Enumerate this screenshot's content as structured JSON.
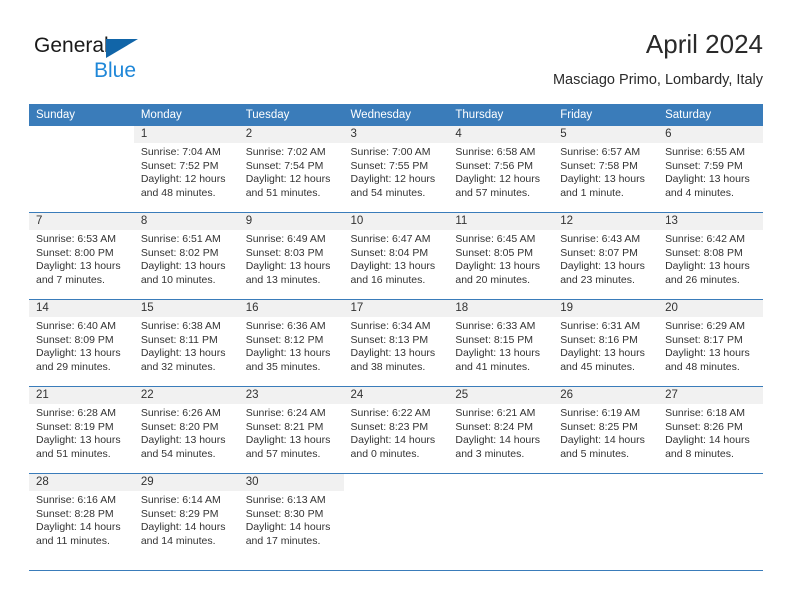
{
  "brand": {
    "name_part1": "General",
    "name_part2": "Blue",
    "triangle_color": "#1165a8",
    "blue_color": "#1f87d8"
  },
  "header": {
    "title": "April 2024",
    "subtitle": "Masciago Primo, Lombardy, Italy"
  },
  "theme": {
    "header_blue": "#3a7cba",
    "daynum_band": "#f1f1f1",
    "text": "#333333"
  },
  "weekdays": [
    "Sunday",
    "Monday",
    "Tuesday",
    "Wednesday",
    "Thursday",
    "Friday",
    "Saturday"
  ],
  "weeks": [
    [
      {
        "day": "",
        "sunrise": "",
        "sunset": "",
        "daylight1": "",
        "daylight2": ""
      },
      {
        "day": "1",
        "sunrise": "Sunrise: 7:04 AM",
        "sunset": "Sunset: 7:52 PM",
        "daylight1": "Daylight: 12 hours",
        "daylight2": "and 48 minutes."
      },
      {
        "day": "2",
        "sunrise": "Sunrise: 7:02 AM",
        "sunset": "Sunset: 7:54 PM",
        "daylight1": "Daylight: 12 hours",
        "daylight2": "and 51 minutes."
      },
      {
        "day": "3",
        "sunrise": "Sunrise: 7:00 AM",
        "sunset": "Sunset: 7:55 PM",
        "daylight1": "Daylight: 12 hours",
        "daylight2": "and 54 minutes."
      },
      {
        "day": "4",
        "sunrise": "Sunrise: 6:58 AM",
        "sunset": "Sunset: 7:56 PM",
        "daylight1": "Daylight: 12 hours",
        "daylight2": "and 57 minutes."
      },
      {
        "day": "5",
        "sunrise": "Sunrise: 6:57 AM",
        "sunset": "Sunset: 7:58 PM",
        "daylight1": "Daylight: 13 hours",
        "daylight2": "and 1 minute."
      },
      {
        "day": "6",
        "sunrise": "Sunrise: 6:55 AM",
        "sunset": "Sunset: 7:59 PM",
        "daylight1": "Daylight: 13 hours",
        "daylight2": "and 4 minutes."
      }
    ],
    [
      {
        "day": "7",
        "sunrise": "Sunrise: 6:53 AM",
        "sunset": "Sunset: 8:00 PM",
        "daylight1": "Daylight: 13 hours",
        "daylight2": "and 7 minutes."
      },
      {
        "day": "8",
        "sunrise": "Sunrise: 6:51 AM",
        "sunset": "Sunset: 8:02 PM",
        "daylight1": "Daylight: 13 hours",
        "daylight2": "and 10 minutes."
      },
      {
        "day": "9",
        "sunrise": "Sunrise: 6:49 AM",
        "sunset": "Sunset: 8:03 PM",
        "daylight1": "Daylight: 13 hours",
        "daylight2": "and 13 minutes."
      },
      {
        "day": "10",
        "sunrise": "Sunrise: 6:47 AM",
        "sunset": "Sunset: 8:04 PM",
        "daylight1": "Daylight: 13 hours",
        "daylight2": "and 16 minutes."
      },
      {
        "day": "11",
        "sunrise": "Sunrise: 6:45 AM",
        "sunset": "Sunset: 8:05 PM",
        "daylight1": "Daylight: 13 hours",
        "daylight2": "and 20 minutes."
      },
      {
        "day": "12",
        "sunrise": "Sunrise: 6:43 AM",
        "sunset": "Sunset: 8:07 PM",
        "daylight1": "Daylight: 13 hours",
        "daylight2": "and 23 minutes."
      },
      {
        "day": "13",
        "sunrise": "Sunrise: 6:42 AM",
        "sunset": "Sunset: 8:08 PM",
        "daylight1": "Daylight: 13 hours",
        "daylight2": "and 26 minutes."
      }
    ],
    [
      {
        "day": "14",
        "sunrise": "Sunrise: 6:40 AM",
        "sunset": "Sunset: 8:09 PM",
        "daylight1": "Daylight: 13 hours",
        "daylight2": "and 29 minutes."
      },
      {
        "day": "15",
        "sunrise": "Sunrise: 6:38 AM",
        "sunset": "Sunset: 8:11 PM",
        "daylight1": "Daylight: 13 hours",
        "daylight2": "and 32 minutes."
      },
      {
        "day": "16",
        "sunrise": "Sunrise: 6:36 AM",
        "sunset": "Sunset: 8:12 PM",
        "daylight1": "Daylight: 13 hours",
        "daylight2": "and 35 minutes."
      },
      {
        "day": "17",
        "sunrise": "Sunrise: 6:34 AM",
        "sunset": "Sunset: 8:13 PM",
        "daylight1": "Daylight: 13 hours",
        "daylight2": "and 38 minutes."
      },
      {
        "day": "18",
        "sunrise": "Sunrise: 6:33 AM",
        "sunset": "Sunset: 8:15 PM",
        "daylight1": "Daylight: 13 hours",
        "daylight2": "and 41 minutes."
      },
      {
        "day": "19",
        "sunrise": "Sunrise: 6:31 AM",
        "sunset": "Sunset: 8:16 PM",
        "daylight1": "Daylight: 13 hours",
        "daylight2": "and 45 minutes."
      },
      {
        "day": "20",
        "sunrise": "Sunrise: 6:29 AM",
        "sunset": "Sunset: 8:17 PM",
        "daylight1": "Daylight: 13 hours",
        "daylight2": "and 48 minutes."
      }
    ],
    [
      {
        "day": "21",
        "sunrise": "Sunrise: 6:28 AM",
        "sunset": "Sunset: 8:19 PM",
        "daylight1": "Daylight: 13 hours",
        "daylight2": "and 51 minutes."
      },
      {
        "day": "22",
        "sunrise": "Sunrise: 6:26 AM",
        "sunset": "Sunset: 8:20 PM",
        "daylight1": "Daylight: 13 hours",
        "daylight2": "and 54 minutes."
      },
      {
        "day": "23",
        "sunrise": "Sunrise: 6:24 AM",
        "sunset": "Sunset: 8:21 PM",
        "daylight1": "Daylight: 13 hours",
        "daylight2": "and 57 minutes."
      },
      {
        "day": "24",
        "sunrise": "Sunrise: 6:22 AM",
        "sunset": "Sunset: 8:23 PM",
        "daylight1": "Daylight: 14 hours",
        "daylight2": "and 0 minutes."
      },
      {
        "day": "25",
        "sunrise": "Sunrise: 6:21 AM",
        "sunset": "Sunset: 8:24 PM",
        "daylight1": "Daylight: 14 hours",
        "daylight2": "and 3 minutes."
      },
      {
        "day": "26",
        "sunrise": "Sunrise: 6:19 AM",
        "sunset": "Sunset: 8:25 PM",
        "daylight1": "Daylight: 14 hours",
        "daylight2": "and 5 minutes."
      },
      {
        "day": "27",
        "sunrise": "Sunrise: 6:18 AM",
        "sunset": "Sunset: 8:26 PM",
        "daylight1": "Daylight: 14 hours",
        "daylight2": "and 8 minutes."
      }
    ],
    [
      {
        "day": "28",
        "sunrise": "Sunrise: 6:16 AM",
        "sunset": "Sunset: 8:28 PM",
        "daylight1": "Daylight: 14 hours",
        "daylight2": "and 11 minutes."
      },
      {
        "day": "29",
        "sunrise": "Sunrise: 6:14 AM",
        "sunset": "Sunset: 8:29 PM",
        "daylight1": "Daylight: 14 hours",
        "daylight2": "and 14 minutes."
      },
      {
        "day": "30",
        "sunrise": "Sunrise: 6:13 AM",
        "sunset": "Sunset: 8:30 PM",
        "daylight1": "Daylight: 14 hours",
        "daylight2": "and 17 minutes."
      },
      {
        "day": "",
        "sunrise": "",
        "sunset": "",
        "daylight1": "",
        "daylight2": ""
      },
      {
        "day": "",
        "sunrise": "",
        "sunset": "",
        "daylight1": "",
        "daylight2": ""
      },
      {
        "day": "",
        "sunrise": "",
        "sunset": "",
        "daylight1": "",
        "daylight2": ""
      },
      {
        "day": "",
        "sunrise": "",
        "sunset": "",
        "daylight1": "",
        "daylight2": ""
      }
    ]
  ]
}
